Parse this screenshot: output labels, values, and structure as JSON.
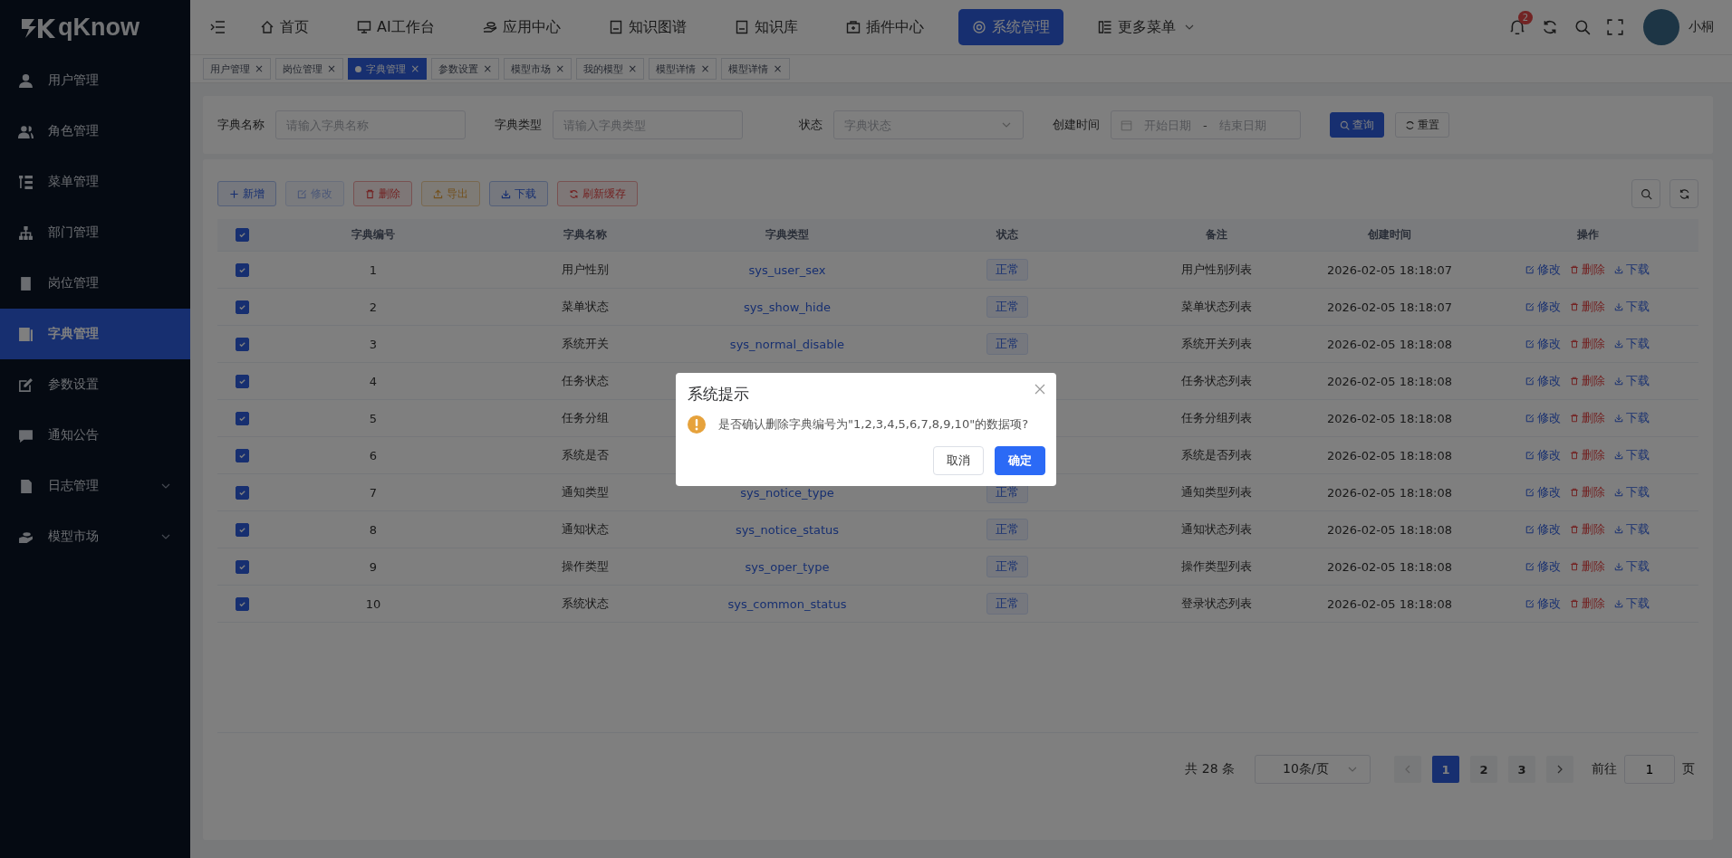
{
  "logo": {
    "text": "qKnow"
  },
  "sidebar": {
    "items": [
      {
        "label": "用户管理",
        "selected": false
      },
      {
        "label": "角色管理",
        "selected": false
      },
      {
        "label": "菜单管理",
        "selected": false
      },
      {
        "label": "部门管理",
        "selected": false
      },
      {
        "label": "岗位管理",
        "selected": false
      },
      {
        "label": "字典管理",
        "selected": true
      },
      {
        "label": "参数设置",
        "selected": false
      },
      {
        "label": "通知公告",
        "selected": false
      },
      {
        "label": "日志管理",
        "selected": false,
        "expandable": true
      },
      {
        "label": "模型市场",
        "selected": false,
        "expandable": true
      }
    ]
  },
  "top_nav": {
    "items": [
      {
        "label": "首页",
        "selected": false
      },
      {
        "label": "AI工作台",
        "selected": false
      },
      {
        "label": "应用中心",
        "selected": false
      },
      {
        "label": "知识图谱",
        "selected": false
      },
      {
        "label": "知识库",
        "selected": false
      },
      {
        "label": "插件中心",
        "selected": false
      },
      {
        "label": "系统管理",
        "selected": true
      },
      {
        "label": "更多菜单",
        "selected": false,
        "expandable": true
      }
    ],
    "notification_count": "2",
    "user_name": "小桐"
  },
  "tags": [
    {
      "label": "用户管理",
      "close": "×",
      "selected": false
    },
    {
      "label": "岗位管理",
      "close": "×",
      "selected": false
    },
    {
      "label": "字典管理",
      "close": "×",
      "selected": true
    },
    {
      "label": "参数设置",
      "close": "×",
      "selected": false
    },
    {
      "label": "模型市场",
      "close": "×",
      "selected": false
    },
    {
      "label": "我的模型",
      "close": "×",
      "selected": false
    },
    {
      "label": "模型详情",
      "close": "×",
      "selected": false
    },
    {
      "label": "模型详情",
      "close": "×",
      "selected": false
    }
  ],
  "search_form": {
    "fields": [
      {
        "label": "字典名称",
        "kind": "input",
        "placeholder": "请输入字典名称"
      },
      {
        "label": "字典类型",
        "kind": "input",
        "placeholder": "请输入字典类型"
      },
      {
        "label": "状态",
        "kind": "select",
        "placeholder": "字典状态"
      },
      {
        "label": "创建时间",
        "kind": "daterange",
        "placeholder": "开始日期",
        "placeholder_end": "结束日期",
        "separator": "-"
      }
    ],
    "buttons": [
      {
        "label": "查询",
        "kind": "primary"
      },
      {
        "label": "重置",
        "kind": "default"
      }
    ]
  },
  "toolbar": {
    "buttons": [
      {
        "label": "新增",
        "kind": "primary",
        "disabled": false
      },
      {
        "label": "修改",
        "kind": "success",
        "disabled": true
      },
      {
        "label": "删除",
        "kind": "danger",
        "disabled": false
      },
      {
        "label": "导出",
        "kind": "warning",
        "disabled": false
      },
      {
        "label": "下载",
        "kind": "primary",
        "disabled": false
      },
      {
        "label": "刷新缓存",
        "kind": "danger",
        "disabled": false
      }
    ]
  },
  "table": {
    "all_checked": true,
    "columns": [
      "字典编号",
      "字典名称",
      "字典类型",
      "状态",
      "备注",
      "创建时间",
      "操作"
    ],
    "rows": [
      {
        "checked": true,
        "id": "1",
        "name": "用户性别",
        "type": "sys_user_sex",
        "status": "正常",
        "remark": "用户性别列表",
        "created": "2026-02-05 18:18:07",
        "actions": [
          {
            "label": "修改",
            "kind": "edit"
          },
          {
            "label": "删除",
            "kind": "delete"
          },
          {
            "label": "下载",
            "kind": "download"
          }
        ]
      },
      {
        "checked": true,
        "id": "2",
        "name": "菜单状态",
        "type": "sys_show_hide",
        "status": "正常",
        "remark": "菜单状态列表",
        "created": "2026-02-05 18:18:07",
        "actions": [
          {
            "label": "修改",
            "kind": "edit"
          },
          {
            "label": "删除",
            "kind": "delete"
          },
          {
            "label": "下载",
            "kind": "download"
          }
        ]
      },
      {
        "checked": true,
        "id": "3",
        "name": "系统开关",
        "type": "sys_normal_disable",
        "status": "正常",
        "remark": "系统开关列表",
        "created": "2026-02-05 18:18:08",
        "actions": [
          {
            "label": "修改",
            "kind": "edit"
          },
          {
            "label": "删除",
            "kind": "delete"
          },
          {
            "label": "下载",
            "kind": "download"
          }
        ]
      },
      {
        "checked": true,
        "id": "4",
        "name": "任务状态",
        "remark": "任务状态列表",
        "created": "2026-02-05 18:18:08",
        "actions": [
          {
            "label": "修改",
            "kind": "edit"
          },
          {
            "label": "删除",
            "kind": "delete"
          },
          {
            "label": "下载",
            "kind": "download"
          }
        ]
      },
      {
        "checked": true,
        "id": "5",
        "name": "任务分组",
        "remark": "任务分组列表",
        "created": "2026-02-05 18:18:08",
        "actions": [
          {
            "label": "修改",
            "kind": "edit"
          },
          {
            "label": "删除",
            "kind": "delete"
          },
          {
            "label": "下载",
            "kind": "download"
          }
        ]
      },
      {
        "checked": true,
        "id": "6",
        "name": "系统是否",
        "remark": "系统是否列表",
        "created": "2026-02-05 18:18:08",
        "actions": [
          {
            "label": "修改",
            "kind": "edit"
          },
          {
            "label": "删除",
            "kind": "delete"
          },
          {
            "label": "下载",
            "kind": "download"
          }
        ]
      },
      {
        "checked": true,
        "id": "7",
        "name": "通知类型",
        "type": "sys_notice_type",
        "status": "正常",
        "remark": "通知类型列表",
        "created": "2026-02-05 18:18:08",
        "actions": [
          {
            "label": "修改",
            "kind": "edit"
          },
          {
            "label": "删除",
            "kind": "delete"
          },
          {
            "label": "下载",
            "kind": "download"
          }
        ]
      },
      {
        "checked": true,
        "id": "8",
        "name": "通知状态",
        "type": "sys_notice_status",
        "status": "正常",
        "remark": "通知状态列表",
        "created": "2026-02-05 18:18:08",
        "actions": [
          {
            "label": "修改",
            "kind": "edit"
          },
          {
            "label": "删除",
            "kind": "delete"
          },
          {
            "label": "下载",
            "kind": "download"
          }
        ]
      },
      {
        "checked": true,
        "id": "9",
        "name": "操作类型",
        "type": "sys_oper_type",
        "status": "正常",
        "remark": "操作类型列表",
        "created": "2026-02-05 18:18:08",
        "actions": [
          {
            "label": "修改",
            "kind": "edit"
          },
          {
            "label": "删除",
            "kind": "delete"
          },
          {
            "label": "下载",
            "kind": "download"
          }
        ]
      },
      {
        "checked": true,
        "id": "10",
        "name": "系统状态",
        "type": "sys_common_status",
        "status": "正常",
        "remark": "登录状态列表",
        "created": "2026-02-05 18:18:08",
        "actions": [
          {
            "label": "修改",
            "kind": "edit"
          },
          {
            "label": "删除",
            "kind": "delete"
          },
          {
            "label": "下载",
            "kind": "download"
          }
        ]
      }
    ]
  },
  "pagination": {
    "total": "共 28 条",
    "page_size": "10条/页",
    "pages": [
      {
        "label": "1",
        "selected": true
      },
      {
        "label": "2",
        "selected": false
      },
      {
        "label": "3",
        "selected": false
      }
    ],
    "goto_label": "前往",
    "goto_value": "1",
    "goto_suffix": "页"
  },
  "dialog": {
    "title": "系统提示",
    "message": "是否确认删除字典编号为\"1,2,3,4,5,6,7,8,9,10\"的数据项?",
    "buttons": [
      {
        "label": "取消",
        "kind": "default"
      },
      {
        "label": "确定",
        "kind": "primary"
      }
    ]
  }
}
